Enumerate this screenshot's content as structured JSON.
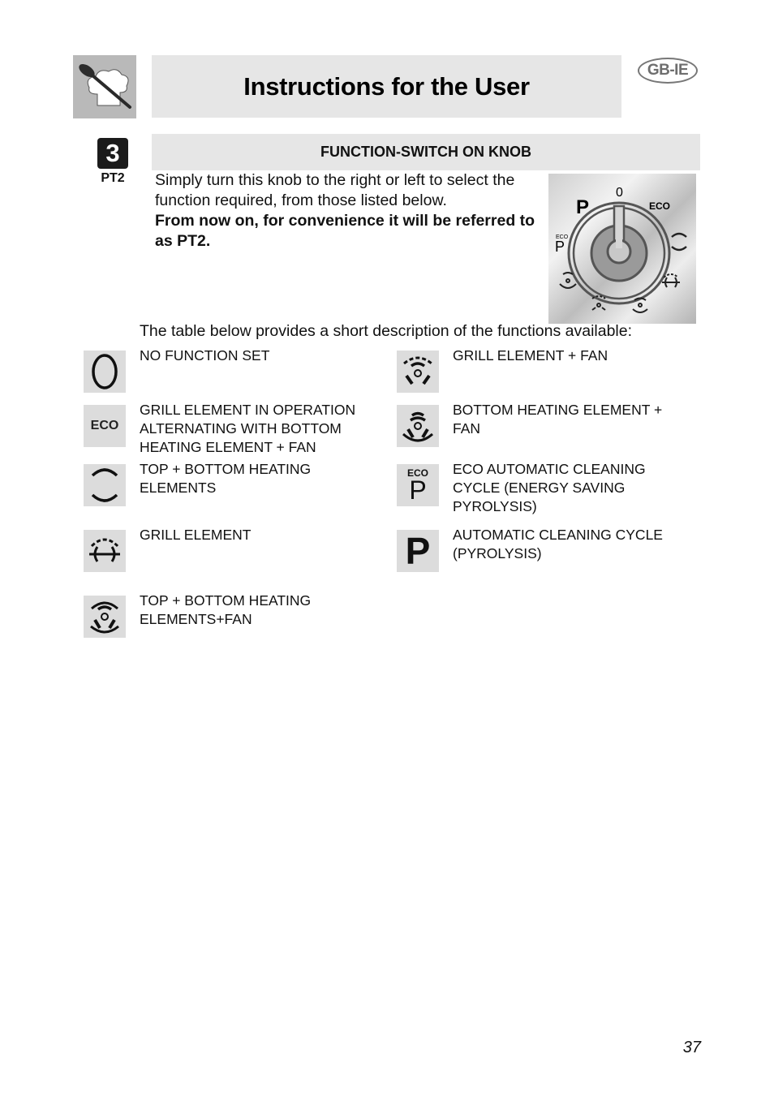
{
  "header": {
    "logo_icon": "chef-hat-spoon-icon",
    "title": "Instructions for the User",
    "language_badge": "GB-IE"
  },
  "section": {
    "number": "3",
    "sub_label": "PT2",
    "heading": "FUNCTION-SWITCH ON KNOB",
    "intro_text": "Simply turn this knob to the right or left to select the function required, from those listed below.",
    "intro_bold": "From now on, for convenience it will be referred to as PT2."
  },
  "knob": {
    "labels": {
      "top": "0",
      "top_left": "P",
      "top_right": "ECO",
      "left_eco": "ECO",
      "left_p": "P"
    },
    "icons": [
      "zero-mark",
      "eco-mark",
      "top-bottom-heating-icon",
      "grill-icon",
      "top-bottom-fan-icon",
      "grill-fan-icon",
      "bottom-fan-icon",
      "eco-pyrolysis-icon",
      "pyrolysis-icon"
    ]
  },
  "table_intro": "The table below provides a short description of the functions available:",
  "functions_left": [
    {
      "icon": "zero-icon",
      "icon_text": "",
      "description": "NO FUNCTION SET"
    },
    {
      "icon": "eco-icon",
      "icon_text": "ECO",
      "description": "GRILL ELEMENT IN OPERATION ALTERNATING WITH BOTTOM HEATING ELEMENT + FAN"
    },
    {
      "icon": "top-bottom-heating-icon",
      "icon_text": "",
      "description": "TOP + BOTTOM HEATING ELEMENTS"
    },
    {
      "icon": "grill-element-icon",
      "icon_text": "",
      "description": "GRILL ELEMENT"
    },
    {
      "icon": "top-bottom-fan-icon",
      "icon_text": "",
      "description": "TOP + BOTTOM HEATING ELEMENTS+FAN"
    }
  ],
  "functions_right": [
    {
      "icon": "grill-fan-icon",
      "icon_text": "",
      "description": "GRILL ELEMENT + FAN"
    },
    {
      "icon": "bottom-fan-icon",
      "icon_text": "",
      "description": "BOTTOM HEATING ELEMENT + FAN"
    },
    {
      "icon": "eco-pyrolysis-icon",
      "icon_text": "ECO",
      "icon_text2": "P",
      "description": "ECO AUTOMATIC CLEANING CYCLE (ENERGY SAVING PYROLYSIS)"
    },
    {
      "icon": "pyrolysis-icon",
      "icon_text": "P",
      "description": "AUTOMATIC CLEANING CYCLE (PYROLYSIS)"
    }
  ],
  "page_number": "37"
}
